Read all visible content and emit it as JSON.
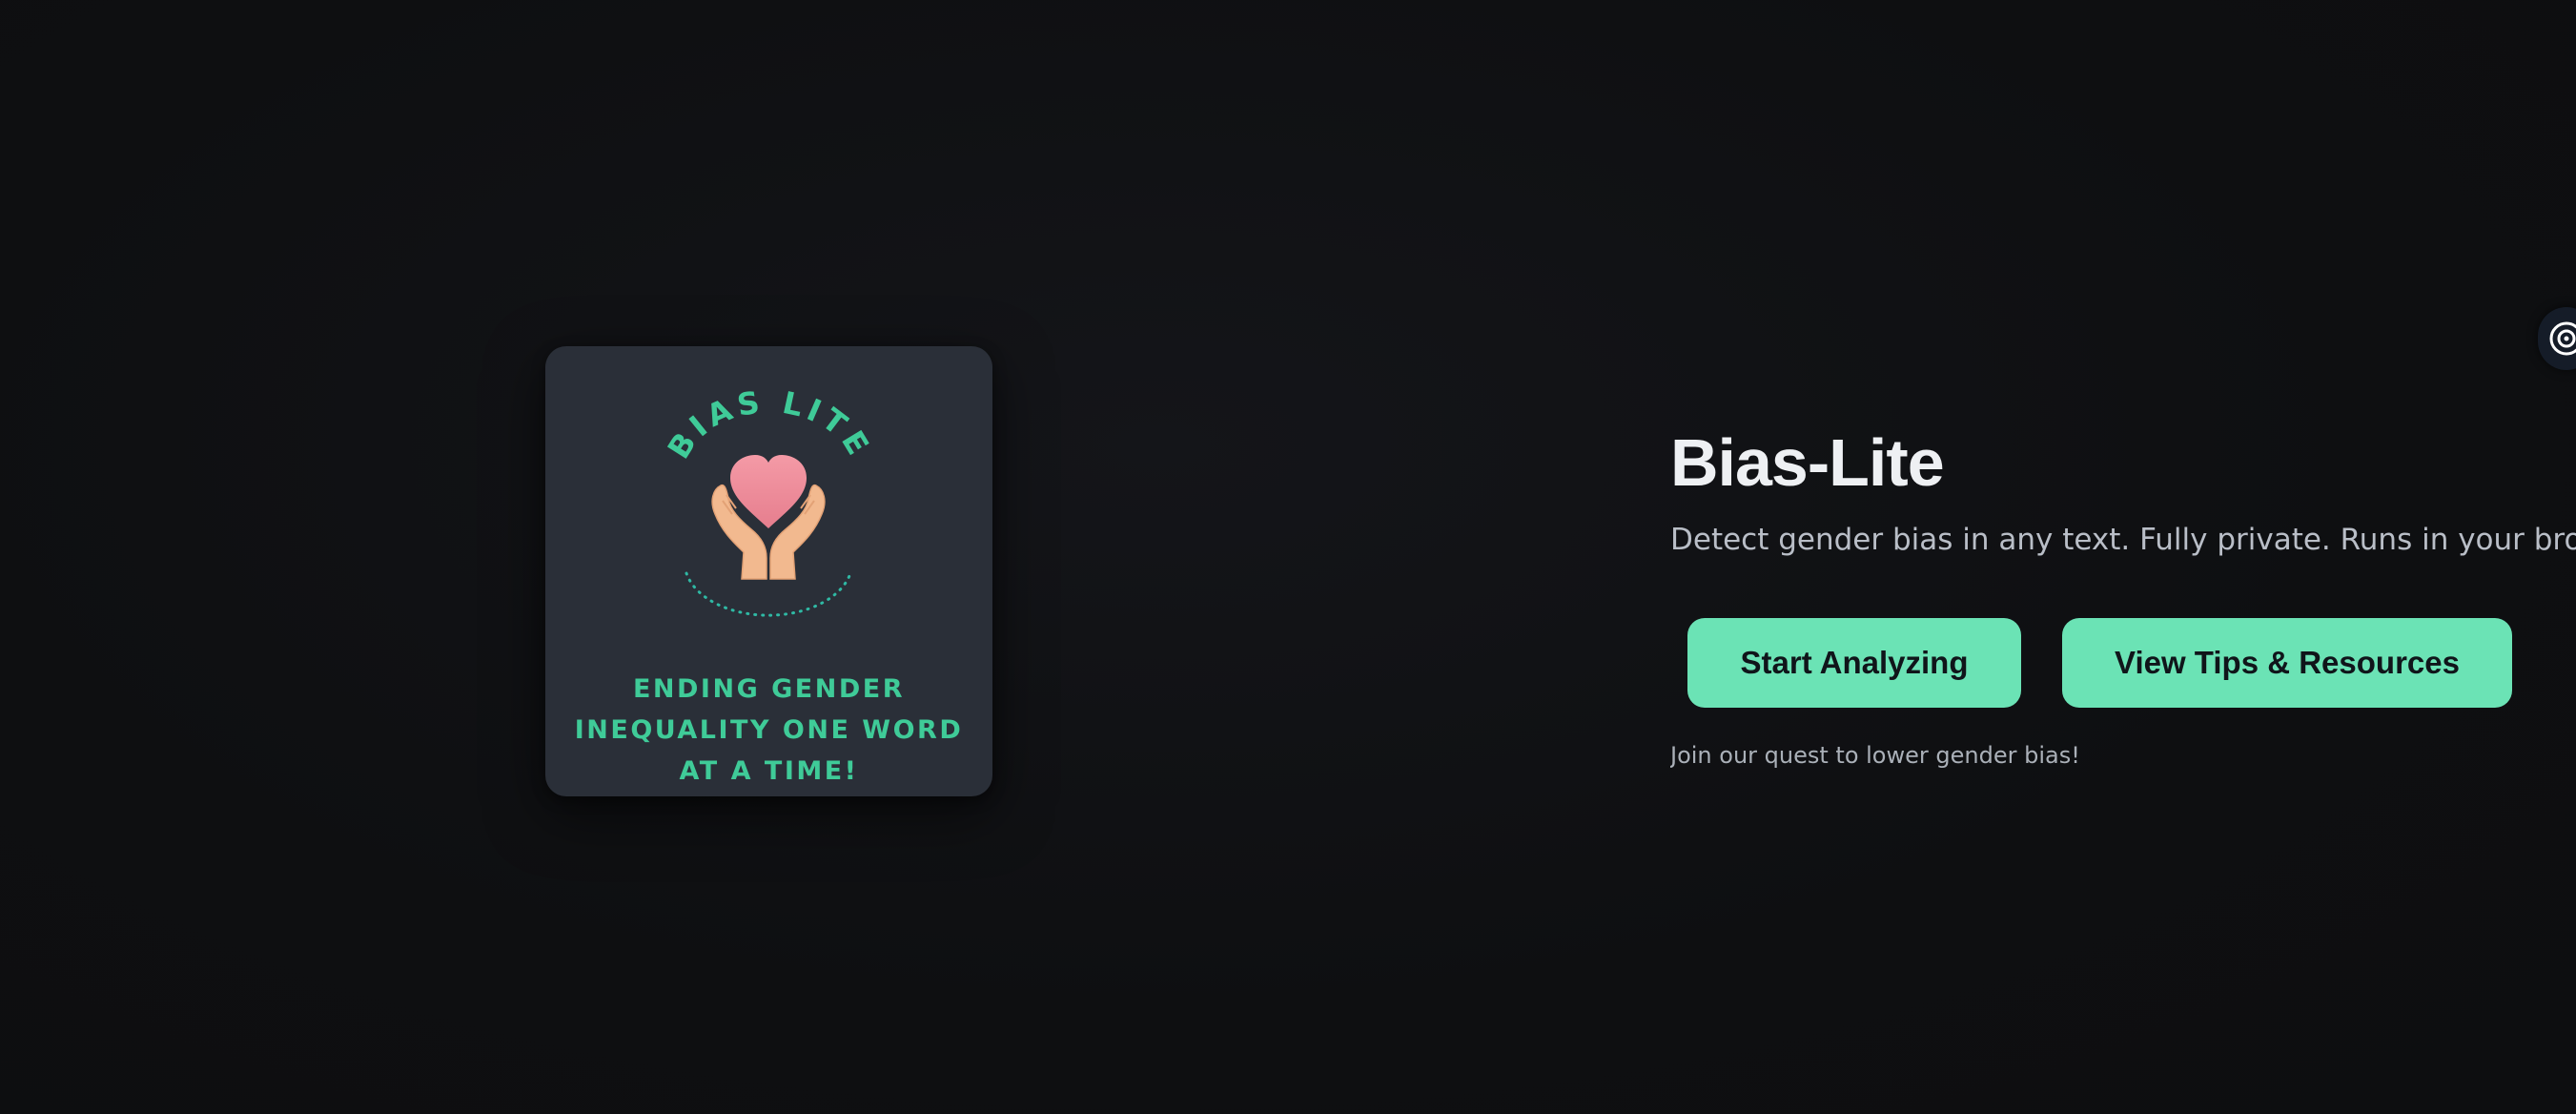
{
  "logo": {
    "brand_text": "BIAS LITE",
    "tagline": "ENDING GENDER INEQUALITY ONE WORD AT A TIME!",
    "icon": "heart-in-hands-icon"
  },
  "hero": {
    "title": "Bias-Lite",
    "subtitle": "Detect gender bias in any text. Fully private. Runs in your browser.",
    "primary_button": "Start Analyzing",
    "secondary_button": "View Tips & Resources",
    "note": "Join our quest to lower gender bias!"
  },
  "widget": {
    "icon": "target-icon"
  },
  "colors": {
    "background": "#0e0f11",
    "card": "#2a2f38",
    "accent_green": "#6be3b5",
    "logo_green": "#3fcb98",
    "heart_pink": "#ee8a99",
    "hand_skin": "#f2b98f",
    "title_text": "#eef0f3"
  }
}
